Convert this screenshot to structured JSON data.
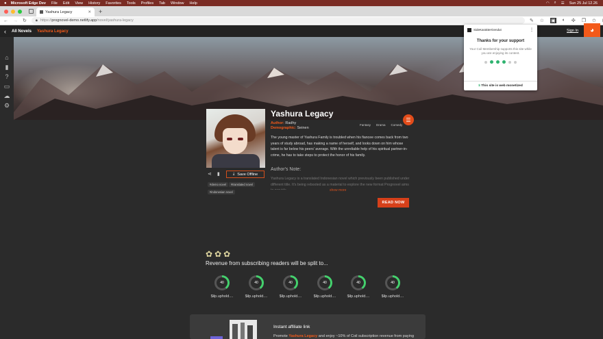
{
  "menubar": {
    "app": "Microsoft Edge Dev",
    "items": [
      "File",
      "Edit",
      "View",
      "History",
      "Favorites",
      "Tools",
      "Profiles",
      "Tab",
      "Window",
      "Help"
    ],
    "datetime": "Sun 25 Jul  12.26"
  },
  "browser": {
    "tab_title": "Yashura Legacy",
    "url_prefix": "https://",
    "url_host": "prognovel-demo.netlify.app",
    "url_path": "/novel/yashura-legacy"
  },
  "site": {
    "back_label": "‹",
    "all_novels": "All Novels",
    "breadcrumb": "Yashura Legacy",
    "sign_in": "Sign In"
  },
  "popup": {
    "site_name": "SideKarakterGendut",
    "title": "Thanks for your support",
    "text": "Your Coil Membership supports this site while you are enjoying its content.",
    "footer": "This site is web monetized"
  },
  "novel": {
    "title": "Yashura Legacy",
    "author_label": "Author:",
    "author": "Radhy",
    "demographic_label": "Demographic:",
    "demographic": "Seinen",
    "genres": [
      "Fantasy",
      "Drama",
      "Comedy"
    ],
    "synopsis": "The young master of Yashura Family is troubled when his fiancee comes back from two years of study abroad, has making a name of herself, and looks down on him whose talent is far below his peers' average. With the unreliable help of his spiritual partner-in-crime, he has to take steps to protect the honor of his family.",
    "authors_note_title": "Author's Note:",
    "authors_note": "Yashura Legacy is a translated Indonesian novel which previously been published under different title. It's being rebooted as a material to explore the new format Prognovel aims to provide.",
    "show_more": "show more",
    "save_offline": "Save Offline",
    "tags": [
      "#demo novel",
      "#translated novel",
      "#indonesian novel"
    ],
    "read_now": "READ NOW"
  },
  "revenue": {
    "title": "Revenue from subscribing readers will be split to...",
    "recipients": [
      {
        "value": 40,
        "label": "$ilp.uphold...."
      },
      {
        "value": 40,
        "label": "$ilp.uphold...."
      },
      {
        "value": 40,
        "label": "$ilp.uphold...."
      },
      {
        "value": 40,
        "label": "$ilp.uphold...."
      },
      {
        "value": 40,
        "label": "$ilp.uphold...."
      },
      {
        "value": 40,
        "label": "$ilp.uphold...."
      }
    ]
  },
  "affiliate": {
    "title": "Instant affiliate link",
    "text_before": "Promote",
    "text_highlight": "Yashura Legacy",
    "text_after": "and enjoy ~10% of Coil subscription revenue from paying"
  },
  "colors": {
    "accent": "#f35a1a",
    "donut_fill": "#44d16d",
    "menubar": "#7a2c24"
  }
}
